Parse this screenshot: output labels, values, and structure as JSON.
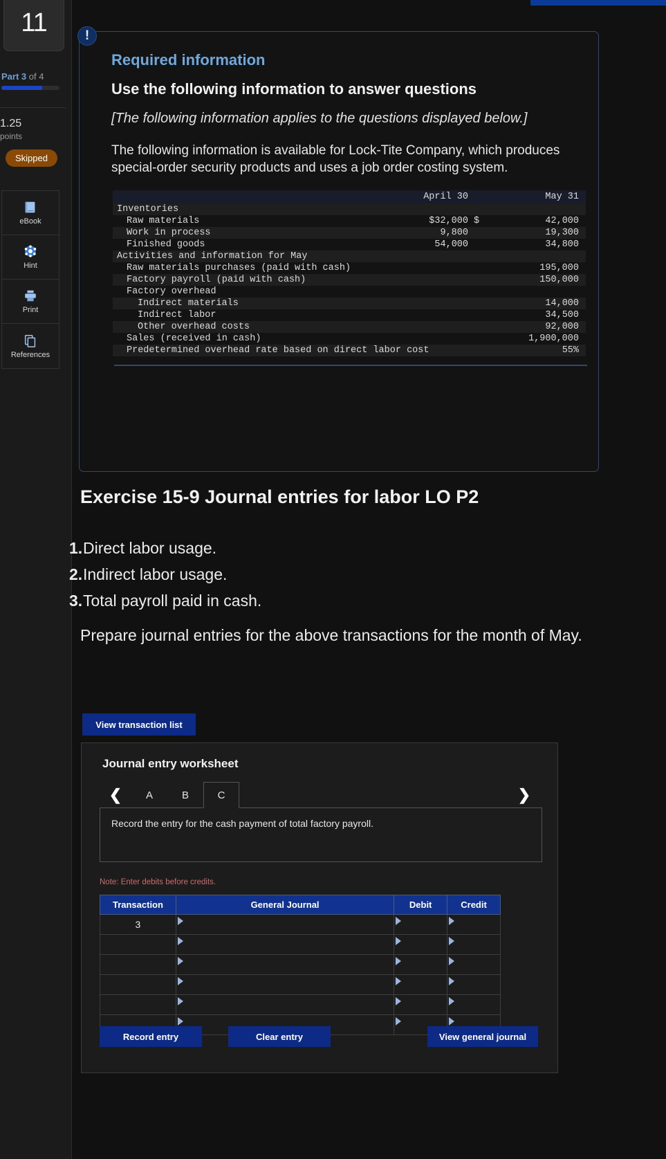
{
  "sidebar": {
    "question_number": "11",
    "part_prefix": "Part",
    "part_current": "3",
    "part_of": "of 4",
    "points_value": "1.25",
    "points_label": "points",
    "status_badge": "Skipped",
    "tools": [
      {
        "label": "eBook",
        "icon": "ebook-icon"
      },
      {
        "label": "Hint",
        "icon": "hint-icon"
      },
      {
        "label": "Print",
        "icon": "print-icon"
      },
      {
        "label": "References",
        "icon": "references-icon"
      }
    ]
  },
  "callout": {
    "badge": "!",
    "kicker": "Required information",
    "heading": "Use the following information to answer questions",
    "italic_note": "[The following information applies to the questions displayed below.]",
    "body": "The following information is available for Lock-Tite Company, which produces special-order security products and uses a job order costing system."
  },
  "acct_table": {
    "col_headers": [
      "",
      "April 30",
      "",
      "May 31"
    ],
    "rows": [
      {
        "label": "Inventories",
        "indent": 0,
        "april": "",
        "sym": "",
        "may": ""
      },
      {
        "label": "Raw materials",
        "indent": 1,
        "april": "$32,000",
        "sym": "$",
        "may": "42,000"
      },
      {
        "label": "Work in process",
        "indent": 1,
        "april": "9,800",
        "sym": "",
        "may": "19,300"
      },
      {
        "label": "Finished goods",
        "indent": 1,
        "april": "54,000",
        "sym": "",
        "may": "34,800"
      },
      {
        "label": "Activities and information for May",
        "indent": 0,
        "april": "",
        "sym": "",
        "may": ""
      },
      {
        "label": "Raw materials purchases (paid with cash)",
        "indent": 1,
        "april": "",
        "sym": "",
        "may": "195,000"
      },
      {
        "label": "Factory payroll (paid with cash)",
        "indent": 1,
        "april": "",
        "sym": "",
        "may": "150,000"
      },
      {
        "label": "Factory overhead",
        "indent": 1,
        "april": "",
        "sym": "",
        "may": ""
      },
      {
        "label": "Indirect materials",
        "indent": 2,
        "april": "",
        "sym": "",
        "may": "14,000"
      },
      {
        "label": "Indirect labor",
        "indent": 2,
        "april": "",
        "sym": "",
        "may": "34,500"
      },
      {
        "label": "Other overhead costs",
        "indent": 2,
        "april": "",
        "sym": "",
        "may": "92,000"
      },
      {
        "label": "Sales (received in cash)",
        "indent": 1,
        "april": "",
        "sym": "",
        "may": "1,900,000"
      },
      {
        "label": "Predetermined overhead rate based on direct labor cost",
        "indent": 1,
        "april": "",
        "sym": "",
        "may": "55%"
      }
    ]
  },
  "exercise": {
    "title": "Exercise 15-9 Journal entries for labor LO P2",
    "items": [
      {
        "num": "1.",
        "text": "Direct labor usage."
      },
      {
        "num": "2.",
        "text": "Indirect labor usage."
      },
      {
        "num": "3.",
        "text": "Total payroll paid in cash."
      }
    ],
    "prepare_text": "Prepare journal entries for the above transactions for the month of May."
  },
  "worksheet": {
    "view_transaction_list_label": "View transaction list",
    "title": "Journal entry worksheet",
    "prev_icon": "chevron-left-icon",
    "next_icon": "chevron-right-icon",
    "tabs": [
      {
        "label": "A",
        "active": false
      },
      {
        "label": "B",
        "active": false
      },
      {
        "label": "C",
        "active": true
      }
    ],
    "description": "Record the entry for the cash payment of total factory payroll.",
    "note": "Note: Enter debits before credits.",
    "table": {
      "headers": [
        "Transaction",
        "General Journal",
        "Debit",
        "Credit"
      ],
      "rows": [
        {
          "transaction": "3",
          "general_journal": "",
          "debit": "",
          "credit": ""
        },
        {
          "transaction": "",
          "general_journal": "",
          "debit": "",
          "credit": ""
        },
        {
          "transaction": "",
          "general_journal": "",
          "debit": "",
          "credit": ""
        },
        {
          "transaction": "",
          "general_journal": "",
          "debit": "",
          "credit": ""
        },
        {
          "transaction": "",
          "general_journal": "",
          "debit": "",
          "credit": ""
        },
        {
          "transaction": "",
          "general_journal": "",
          "debit": "",
          "credit": ""
        }
      ]
    },
    "buttons": {
      "record_entry": "Record entry",
      "clear_entry": "Clear entry",
      "view_general_journal": "View general journal"
    }
  },
  "colors": {
    "accent_blue": "#0c2a86",
    "header_blue": "#11328e",
    "link_blue": "#6fa8dc",
    "skipped_orange": "#8a4a07",
    "note_red": "#cf6b6b"
  }
}
